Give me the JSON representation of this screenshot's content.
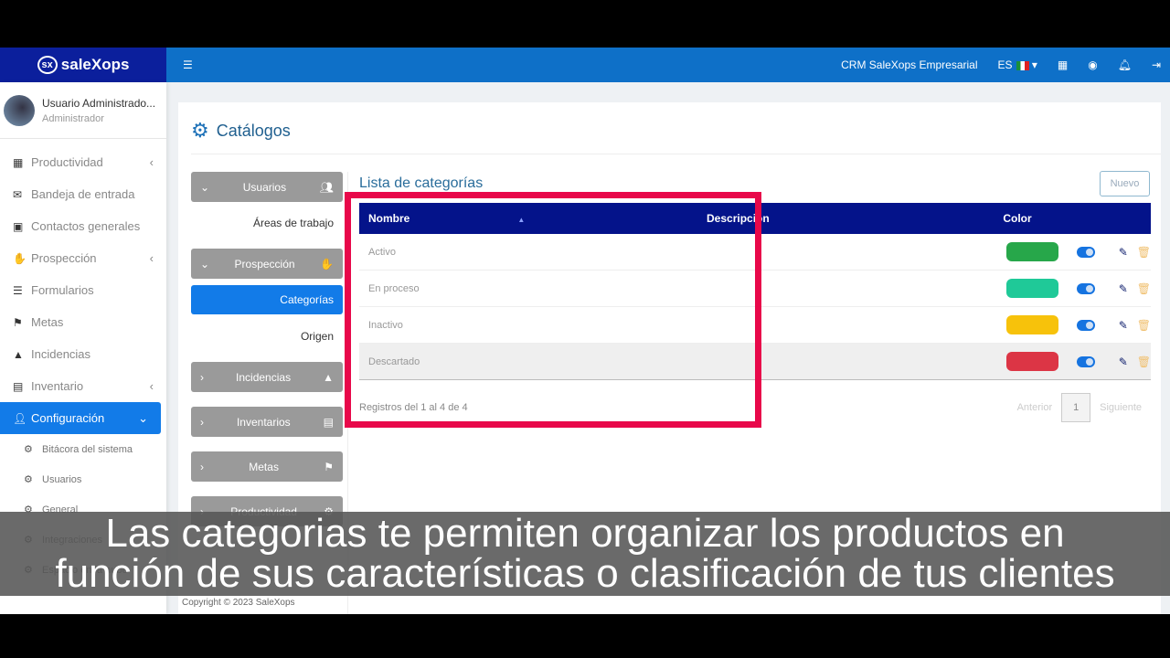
{
  "brand": {
    "logo": "sx",
    "name": "saleXops",
    "color": "#0b1f9c"
  },
  "topbar": {
    "menu_icon": "hamburger-icon",
    "company": "CRM SaleXops Empresarial",
    "lang": "ES",
    "icons": [
      "cake-icon",
      "stopwatch-icon",
      "bell-icon",
      "logout-icon"
    ]
  },
  "user": {
    "name": "Usuario Administrado...",
    "role": "Administrador"
  },
  "sidebar": {
    "items": [
      {
        "label": "Productividad",
        "icon": "calendar-icon",
        "chev": "‹"
      },
      {
        "label": "Bandeja de entrada",
        "icon": "envelope-icon"
      },
      {
        "label": "Contactos generales",
        "icon": "contact-book-icon"
      },
      {
        "label": "Prospección",
        "icon": "handshake-icon",
        "chev": "‹"
      },
      {
        "label": "Formularios",
        "icon": "list-ol-icon"
      },
      {
        "label": "Metas",
        "icon": "flag-icon"
      },
      {
        "label": "Incidencias",
        "icon": "warning-icon"
      },
      {
        "label": "Inventario",
        "icon": "list-alt-icon",
        "chev": "‹"
      },
      {
        "label": "Configuración",
        "icon": "user-cog-icon",
        "chev": "⌄",
        "active": true
      }
    ],
    "subitems": [
      {
        "label": "Bitácora del sistema"
      },
      {
        "label": "Usuarios"
      },
      {
        "label": "General"
      },
      {
        "label": "Integraciones"
      },
      {
        "label": "Espacio en la nube"
      }
    ]
  },
  "page": {
    "title": "Catálogos"
  },
  "catalog": {
    "groups": [
      {
        "label": "Usuarios",
        "expanded": true,
        "children": [
          "Áreas de trabajo"
        ]
      },
      {
        "label": "Prospección",
        "expanded": true,
        "children": [
          "Categorías",
          "Origen"
        ],
        "selected": "Categorías"
      },
      {
        "label": "Incidencias"
      },
      {
        "label": "Inventarios"
      },
      {
        "label": "Metas"
      },
      {
        "label": "Productividad"
      }
    ]
  },
  "list": {
    "title": "Lista de categorías",
    "new_button": "Nuevo",
    "columns": [
      "Nombre",
      "Descripción",
      "Color"
    ],
    "rows": [
      {
        "name": "Activo",
        "description": "",
        "color": "#27a74a",
        "enabled": true
      },
      {
        "name": "En proceso",
        "description": "",
        "color": "#1fc998",
        "enabled": true
      },
      {
        "name": "Inactivo",
        "description": "",
        "color": "#f7c20b",
        "enabled": true
      },
      {
        "name": "Descartado",
        "description": "",
        "color": "#dc3545",
        "enabled": true
      }
    ],
    "info": "Registros del 1 al 4 de 4",
    "prev": "Anterior",
    "page": "1",
    "next": "Siguiente"
  },
  "footer": {
    "copyright": "Copyright © 2023 SaleXops"
  },
  "highlight_color": "#e8084a",
  "subtitle": {
    "line1": "Las categorias te permiten organizar los productos en",
    "line2": "función de sus características o clasificación de tus clientes"
  }
}
